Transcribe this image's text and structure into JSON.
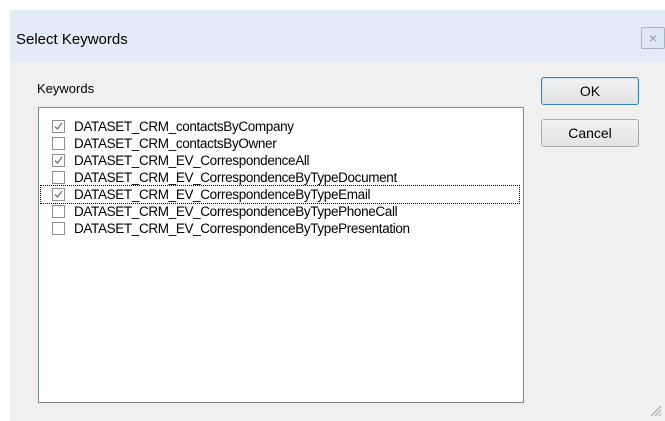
{
  "dialog": {
    "title": "Select Keywords",
    "close_label": "×"
  },
  "keywords": {
    "label": "Keywords",
    "items": [
      {
        "label": "DATASET_CRM_contactsByCompany",
        "checked": true
      },
      {
        "label": "DATASET_CRM_contactsByOwner",
        "checked": false
      },
      {
        "label": "DATASET_CRM_EV_CorrespondenceAll",
        "checked": true
      },
      {
        "label": "DATASET_CRM_EV_CorrespondenceByTypeDocument",
        "checked": false
      },
      {
        "label": "DATASET_CRM_EV_CorrespondenceByTypeEmail",
        "checked": true
      },
      {
        "label": "DATASET_CRM_EV_CorrespondenceByTypePhoneCall",
        "checked": false
      },
      {
        "label": "DATASET_CRM_EV_CorrespondenceByTypePresentation",
        "checked": false
      }
    ]
  },
  "buttons": {
    "ok_label": "OK",
    "cancel_label": "Cancel"
  }
}
